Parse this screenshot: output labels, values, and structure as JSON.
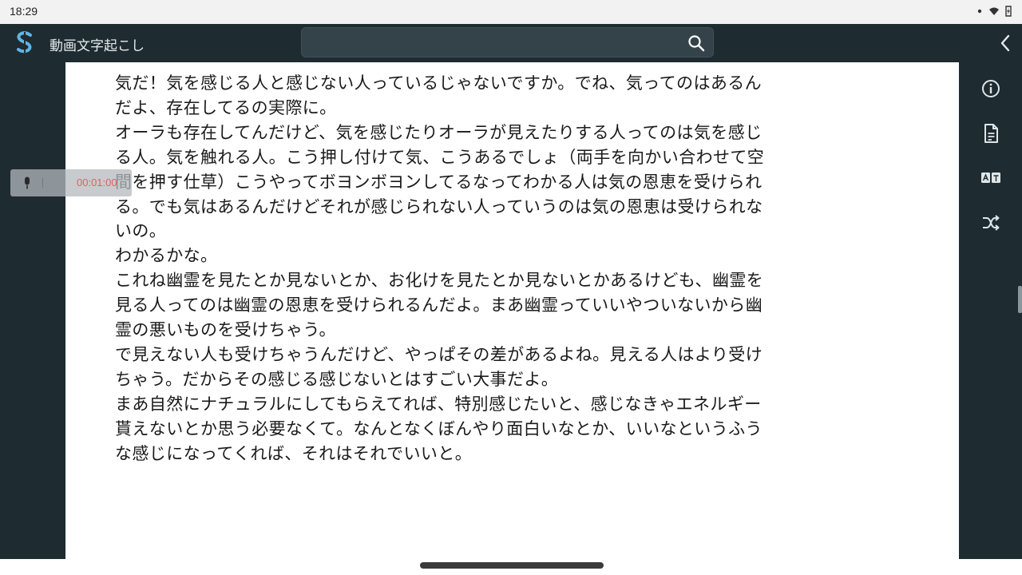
{
  "status_bar": {
    "time": "18:29"
  },
  "app_bar": {
    "title": "動画文字起こし",
    "search_placeholder": ""
  },
  "player": {
    "time": "00:01:00"
  },
  "transcript": {
    "lines": [
      "気だ！気を感じる人と感じない人っているじゃないですか。でね、気ってのはあるん",
      "だよ、存在してるの実際に。",
      "オーラも存在してんだけど、気を感じたりオーラが見えたりする人ってのは気を感じ",
      "る人。気を触れる人。こう押し付けて気、こうあるでしょ（両手を向かい合わせて空",
      "間を押す仕草）こうやってボヨンボヨンしてるなってわかる人は気の恩恵を受けられ",
      "る。でも気はあるんだけどそれが感じられない人っていうのは気の恩恵は受けられな",
      "いの。",
      "わかるかな。",
      "これね幽霊を見たとか見ないとか、お化けを見たとか見ないとかあるけども、幽霊を",
      "見る人ってのは幽霊の恩恵を受けられるんだよ。まあ幽霊っていいやついないから幽",
      "霊の悪いものを受けちゃう。",
      "で見えない人も受けちゃうんだけど、やっぱその差があるよね。見える人はより受け",
      "ちゃう。だからその感じる感じないとはすごい大事だよ。",
      "まあ自然にナチュラルにしてもらえてれば、特別感じたいと、感じなきゃエネルギー",
      "貰えないとか思う必要なくて。なんとなくぼんやり面白いなとか、いいなというふう",
      "な感じになってくれば、それはそれでいいと。"
    ]
  },
  "icons": {
    "logo": "app-logo-icon",
    "search": "search-icon",
    "back": "chevron-left-icon",
    "right_panel": [
      "info-icon",
      "document-icon",
      "translate-icon",
      "shuffle-icon"
    ],
    "mic": "microphone-icon",
    "status": [
      "dot-icon",
      "wifi-icon",
      "battery-icon"
    ]
  },
  "colors": {
    "app_bar": "#1e2b30",
    "search_box": "#344349",
    "accent_logo": "#5fb4e6",
    "player_time": "#e06060"
  }
}
